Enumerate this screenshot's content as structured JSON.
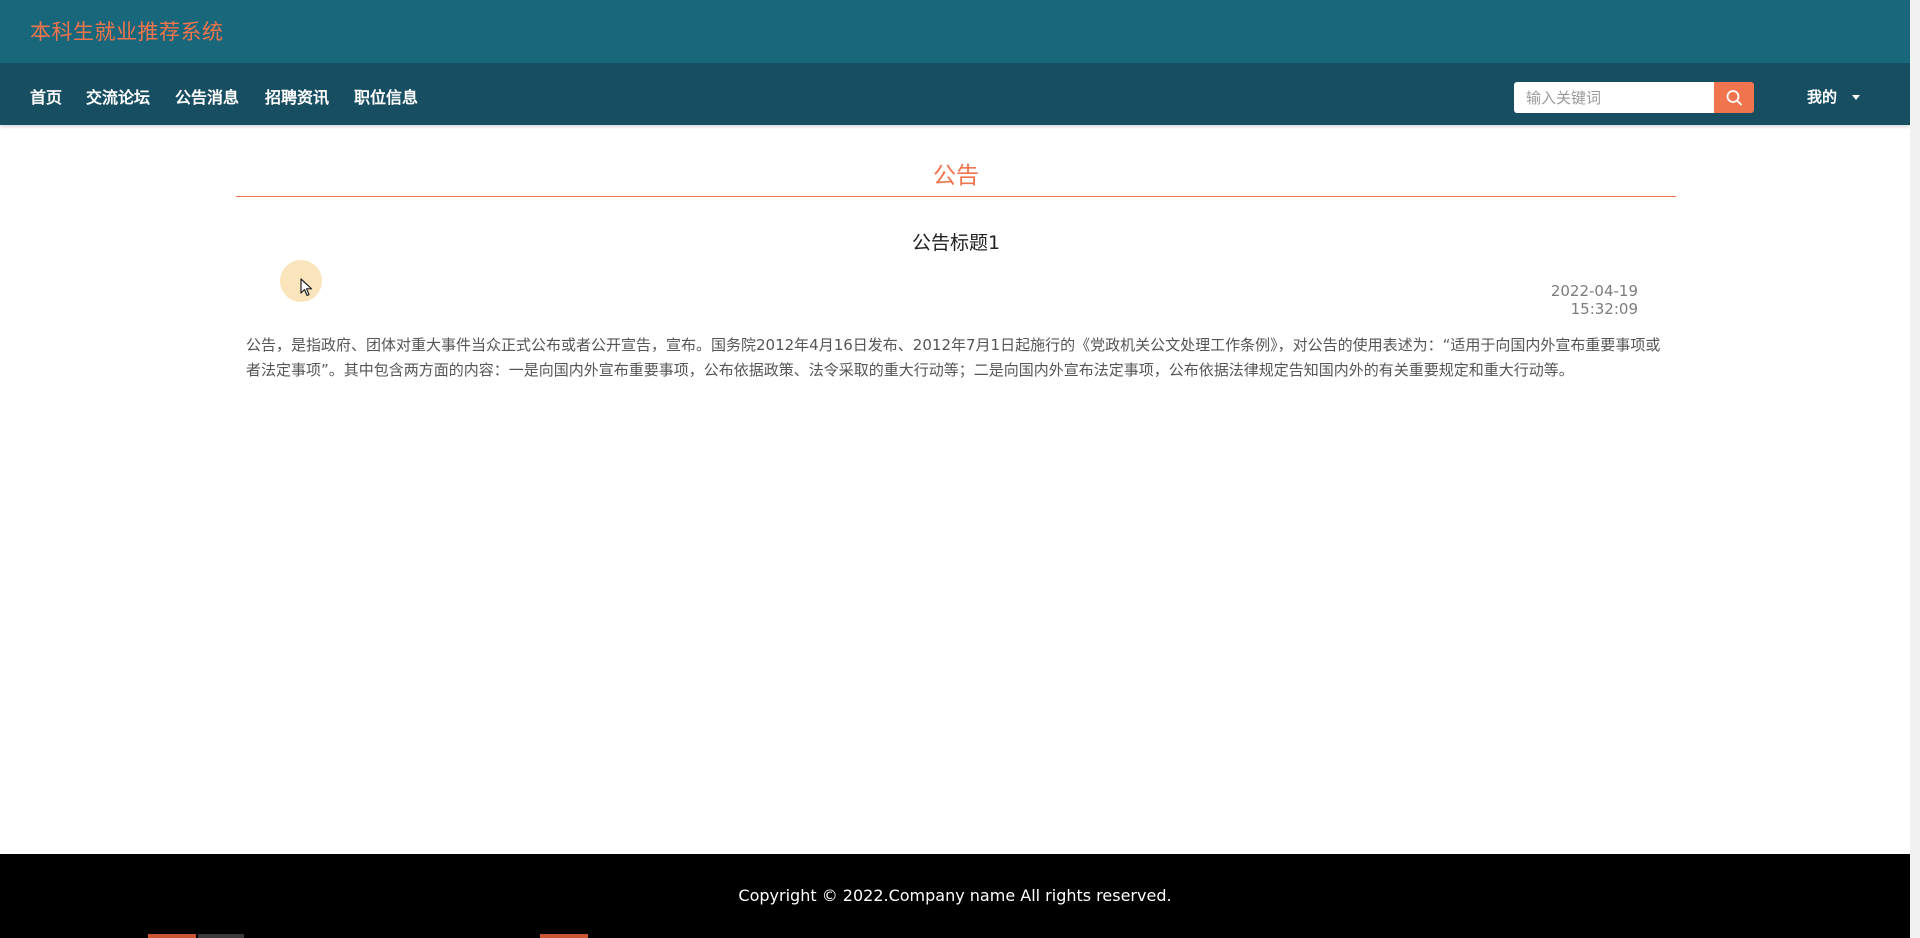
{
  "header": {
    "site_title": "本科生就业推荐系统"
  },
  "nav": {
    "items": [
      {
        "label": "首页"
      },
      {
        "label": "交流论坛"
      },
      {
        "label": "公告消息"
      },
      {
        "label": "招聘资讯"
      },
      {
        "label": "职位信息"
      }
    ],
    "search": {
      "placeholder": "输入关键词",
      "icon": "search-icon"
    },
    "user_menu": {
      "label": "我的",
      "icon": "caret-down-icon"
    }
  },
  "main": {
    "section_title": "公告",
    "notice": {
      "title": "公告标题1",
      "date": "2022-04-19 15:32:09",
      "body": "公告，是指政府、团体对重大事件当众正式公布或者公开宣告，宣布。国务院2012年4月16日发布、2012年7月1日起施行的《党政机关公文处理工作条例》，对公告的使用表述为：“适用于向国内外宣布重要事项或者法定事项”。其中包含两方面的内容：一是向国内外宣布重要事项，公布依据政策、法令采取的重大行动等；二是向国内外宣布法定事项，公布依据法律规定告知国内外的有关重要规定和重大行动等。"
    }
  },
  "footer": {
    "copyright": "Copyright © 2022.Company name All rights reserved."
  },
  "colors": {
    "header_bg": "#18677a",
    "nav_bg": "#174e62",
    "accent": "#f0744d",
    "footer_bg": "#000000"
  }
}
